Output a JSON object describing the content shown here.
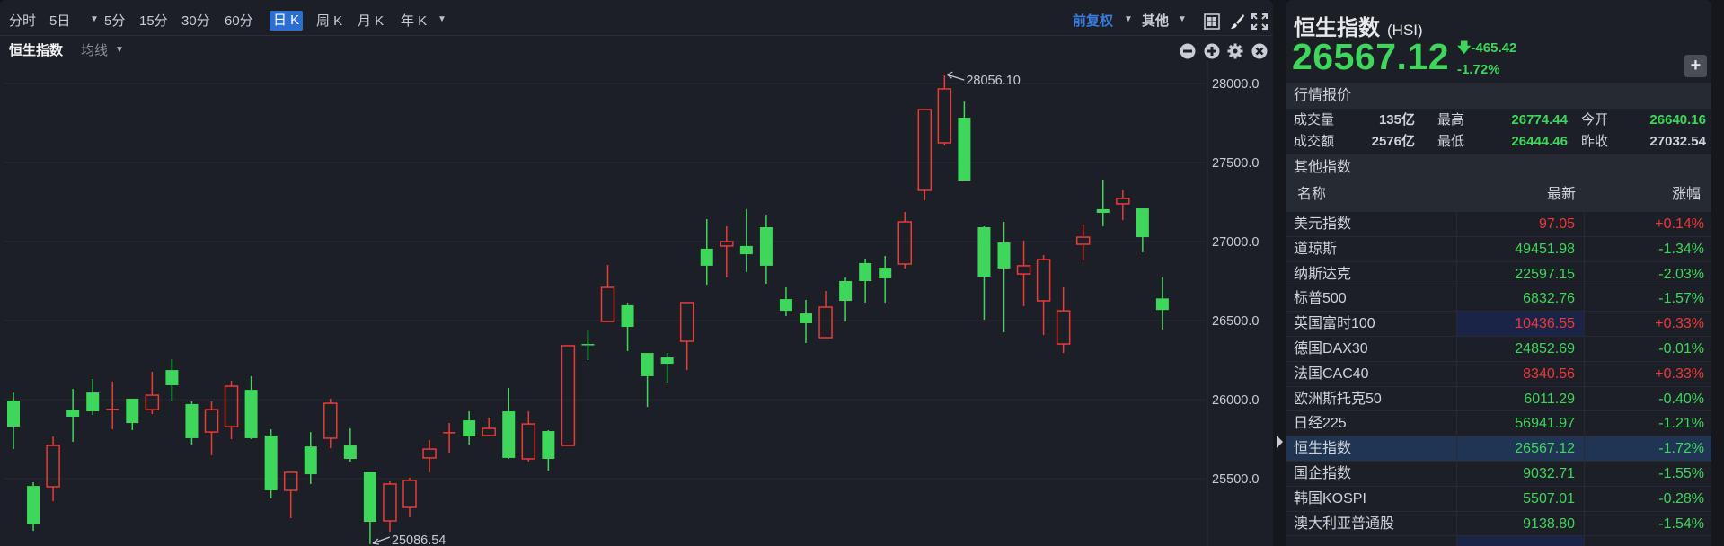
{
  "toolbar": {
    "periods": [
      "分时",
      "5日",
      "5分",
      "15分",
      "30分",
      "60分",
      "日 K",
      "周 K",
      "月 K",
      "年 K"
    ],
    "active": "日 K",
    "adjust_label": "前复权",
    "other_label": "其他"
  },
  "subbar": {
    "symbol_label": "恒生指数",
    "ma_label": "均线"
  },
  "colors": {
    "up": "#ea3a3a",
    "down": "#3fd65c",
    "bg": "#1c1f26",
    "grid": "#2a2e37",
    "accent": "#2c6fd1"
  },
  "chart_data": {
    "type": "candlestick",
    "yticks": [
      28000,
      27500,
      27000,
      26500,
      26000,
      25500
    ],
    "ytick_labels": [
      "28000.0",
      "27500.0",
      "27000.0",
      "26500.0",
      "26000.0",
      "25500.0"
    ],
    "ylim": [
      24930,
      28060
    ],
    "grid": true,
    "max_annotation": "28056.10",
    "min_annotation": "25086.54",
    "candles": [
      [
        25994,
        26045,
        25687,
        25829
      ],
      [
        25454,
        25477,
        25170,
        25210
      ],
      [
        25449,
        25767,
        25358,
        25710
      ],
      [
        25937,
        26068,
        25733,
        25892
      ],
      [
        26045,
        26131,
        25903,
        25926
      ],
      [
        25943,
        26114,
        25812,
        25943
      ],
      [
        26006,
        26006,
        25807,
        25852
      ],
      [
        25937,
        26176,
        25909,
        26028
      ],
      [
        26187,
        26256,
        25989,
        26091
      ],
      [
        25972,
        25989,
        25716,
        25756
      ],
      [
        25795,
        25989,
        25648,
        25937
      ],
      [
        25829,
        26119,
        25750,
        26085
      ],
      [
        26062,
        26148,
        25750,
        25756
      ],
      [
        25773,
        25812,
        25375,
        25426
      ],
      [
        25426,
        25540,
        25250,
        25540
      ],
      [
        25704,
        25795,
        25466,
        25528
      ],
      [
        25756,
        26006,
        25693,
        25977
      ],
      [
        25710,
        25818,
        25608,
        25625
      ],
      [
        25540,
        25540,
        25086.54,
        25227
      ],
      [
        25233,
        25483,
        25165,
        25466
      ],
      [
        25318,
        25506,
        25256,
        25489
      ],
      [
        25631,
        25744,
        25540,
        25687
      ],
      [
        25795,
        25852,
        25665,
        25795
      ],
      [
        25869,
        25926,
        25716,
        25767
      ],
      [
        25773,
        25886,
        25767,
        25818
      ],
      [
        25926,
        26074,
        25625,
        25631
      ],
      [
        25625,
        25926,
        25608,
        25846
      ],
      [
        25801,
        25807,
        25551,
        25625
      ],
      [
        25710,
        26341,
        25710,
        26341
      ],
      [
        26352,
        26437,
        26250,
        26350
      ],
      [
        26494,
        26852,
        26494,
        26710
      ],
      [
        26597,
        26614,
        26307,
        26460
      ],
      [
        26295,
        26295,
        25954,
        26148
      ],
      [
        26267,
        26295,
        26108,
        26227
      ],
      [
        26369,
        26614,
        26187,
        26614
      ],
      [
        26955,
        27142,
        26727,
        26847
      ],
      [
        26972,
        27097,
        26773,
        27000
      ],
      [
        26972,
        27205,
        26807,
        26920
      ],
      [
        27091,
        27170,
        26733,
        26847
      ],
      [
        26636,
        26710,
        26528,
        26562
      ],
      [
        26545,
        26631,
        26358,
        26483
      ],
      [
        26392,
        26687,
        26392,
        26585
      ],
      [
        26750,
        26773,
        26494,
        26625
      ],
      [
        26864,
        26892,
        26614,
        26750
      ],
      [
        26835,
        26909,
        26614,
        26767
      ],
      [
        26858,
        27187,
        26830,
        27125
      ],
      [
        27324,
        27835,
        27261,
        27835
      ],
      [
        27625,
        28056.1,
        27608,
        27966
      ],
      [
        27784,
        27886,
        27386,
        27386
      ],
      [
        27091,
        27097,
        26506,
        26778
      ],
      [
        26994,
        27125,
        26426,
        26830
      ],
      [
        26795,
        27006,
        26591,
        26847
      ],
      [
        26625,
        26915,
        26409,
        26886
      ],
      [
        26352,
        26710,
        26295,
        26562
      ],
      [
        26983,
        27108,
        26881,
        27028
      ],
      [
        27205,
        27392,
        27097,
        27182
      ],
      [
        27239,
        27324,
        27136,
        27273
      ],
      [
        27210,
        27210,
        26932,
        27028
      ],
      [
        26640.16,
        26774.44,
        26444.46,
        26567.12
      ]
    ],
    "candle_format": "open, high, low, close"
  },
  "quote": {
    "name": "恒生指数",
    "code": "(HSI)",
    "price": "26567.12",
    "change": "-465.42",
    "change_pct": "-1.72%",
    "section_quote": "行情报价",
    "stats": {
      "volume_label": "成交量",
      "volume": "135亿",
      "high_label": "最高",
      "high": "26774.44",
      "open_label": "今开",
      "open": "26640.16",
      "turnover_label": "成交额",
      "turnover": "2576亿",
      "low_label": "最低",
      "low": "26444.46",
      "prev_close_label": "昨收",
      "prev_close": "27032.54"
    },
    "section_other": "其他指数"
  },
  "indices": {
    "headers": [
      "名称",
      "最新",
      "涨幅"
    ],
    "rows": [
      {
        "name": "美元指数",
        "last": "97.05",
        "pct": "+0.14%",
        "dir": "up"
      },
      {
        "name": "道琼斯",
        "last": "49451.98",
        "pct": "-1.34%",
        "dir": "down"
      },
      {
        "name": "纳斯达克",
        "last": "22597.15",
        "pct": "-2.03%",
        "dir": "down"
      },
      {
        "name": "标普500",
        "last": "6832.76",
        "pct": "-1.57%",
        "dir": "down"
      },
      {
        "name": "英国富时100",
        "last": "10436.55",
        "pct": "+0.33%",
        "dir": "up"
      },
      {
        "name": "德国DAX30",
        "last": "24852.69",
        "pct": "-0.01%",
        "dir": "down"
      },
      {
        "name": "法国CAC40",
        "last": "8340.56",
        "pct": "+0.33%",
        "dir": "up"
      },
      {
        "name": "欧洲斯托克50",
        "last": "6011.29",
        "pct": "-0.40%",
        "dir": "down"
      },
      {
        "name": "日经225",
        "last": "56941.97",
        "pct": "-1.21%",
        "dir": "down"
      },
      {
        "name": "恒生指数",
        "last": "26567.12",
        "pct": "-1.72%",
        "dir": "down"
      },
      {
        "name": "国企指数",
        "last": "9032.71",
        "pct": "-1.55%",
        "dir": "down"
      },
      {
        "name": "韩国KOSPI",
        "last": "5507.01",
        "pct": "-0.28%",
        "dir": "down"
      },
      {
        "name": "澳大利亚普通股",
        "last": "9138.80",
        "pct": "-1.54%",
        "dir": "down"
      }
    ]
  }
}
